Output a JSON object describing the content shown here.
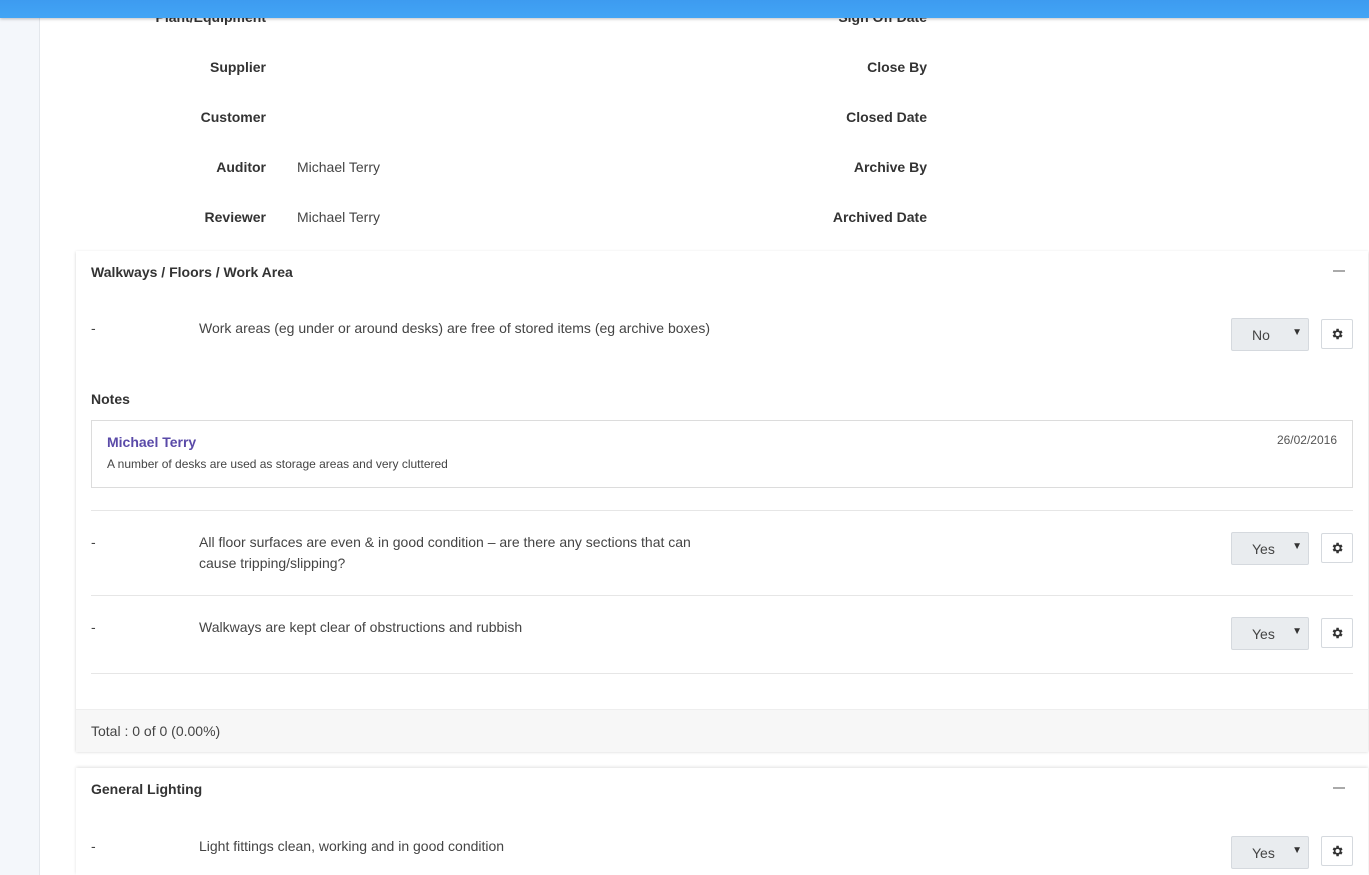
{
  "header_fields": {
    "left": [
      {
        "label": "Plant/Equipment",
        "value": ""
      },
      {
        "label": "Supplier",
        "value": ""
      },
      {
        "label": "Customer",
        "value": ""
      },
      {
        "label": "Auditor",
        "value": "Michael Terry"
      },
      {
        "label": "Reviewer",
        "value": "Michael Terry"
      }
    ],
    "right": [
      {
        "label": "Sign Off Date",
        "value": ""
      },
      {
        "label": "Close By",
        "value": ""
      },
      {
        "label": "Closed Date",
        "value": ""
      },
      {
        "label": "Archive By",
        "value": ""
      },
      {
        "label": "Archived Date",
        "value": ""
      }
    ]
  },
  "sections": [
    {
      "title": "Walkways / Floors / Work Area",
      "questions": [
        {
          "dash": "-",
          "text": "Work areas (eg under or around desks) are free of stored items (eg archive boxes)",
          "answer": "No"
        },
        {
          "dash": "-",
          "text": "All floor surfaces are even & in good condition – are there any sections that can cause tripping/slipping?",
          "answer": "Yes"
        },
        {
          "dash": "-",
          "text": "Walkways are kept clear of obstructions and rubbish",
          "answer": "Yes"
        }
      ],
      "notes_label": "Notes",
      "note": {
        "author": "Michael Terry",
        "date": "26/02/2016",
        "text": "A number of desks are used as storage areas and very cluttered"
      },
      "footer": "Total : 0 of 0 (0.00%)"
    },
    {
      "title": "General Lighting",
      "questions": [
        {
          "dash": "-",
          "text": "Light fittings clean, working and in good condition",
          "answer": "Yes"
        }
      ]
    }
  ],
  "select_caret": "▼"
}
